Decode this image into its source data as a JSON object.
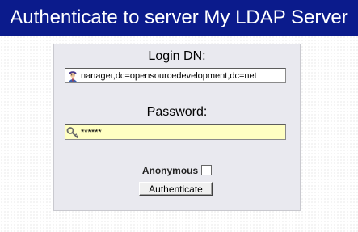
{
  "header": {
    "title": "Authenticate to server My LDAP Server"
  },
  "form": {
    "login_label": "Login DN:",
    "login_value": "nanager,dc=opensourcedevelopment,dc=net",
    "login_icon": "user-icon",
    "password_label": "Password:",
    "password_value": "******",
    "password_icon": "key-icon",
    "anonymous_label": "Anonymous",
    "anonymous_checked": false,
    "submit_label": "Authenticate"
  },
  "colors": {
    "header_bg": "#0b1b8c",
    "password_bg": "#ffffc2"
  }
}
